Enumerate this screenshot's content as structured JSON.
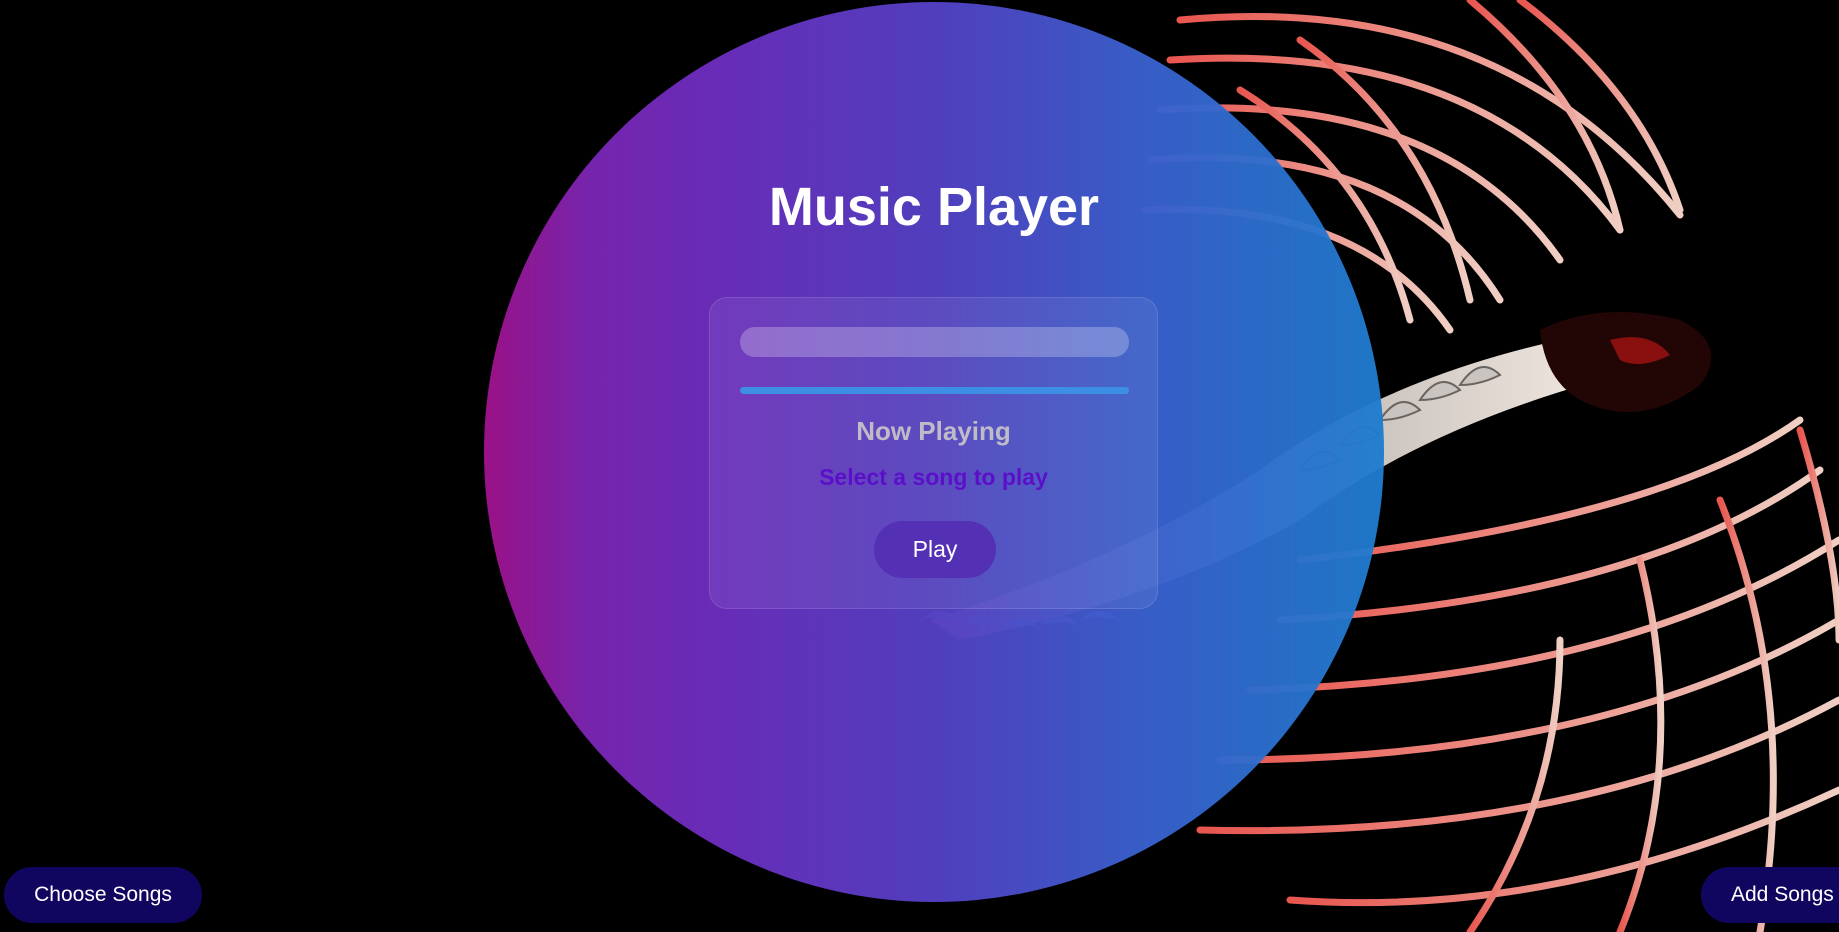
{
  "app": {
    "title": "Music Player"
  },
  "player": {
    "search_value": "",
    "search_placeholder": "",
    "progress_fraction": 1.0,
    "now_playing_label": "Now Playing",
    "current_song": "Select a song to play",
    "play_label": "Play"
  },
  "footer": {
    "choose_label": "Choose Songs",
    "add_label": "Add Songs"
  },
  "background": {
    "icon": "dragon-illustration",
    "colors": {
      "accent_purple": "#6a2fc0",
      "accent_blue": "#1f7ccf",
      "dragon_red": "#e05a55",
      "button_navy": "#11065f"
    }
  }
}
